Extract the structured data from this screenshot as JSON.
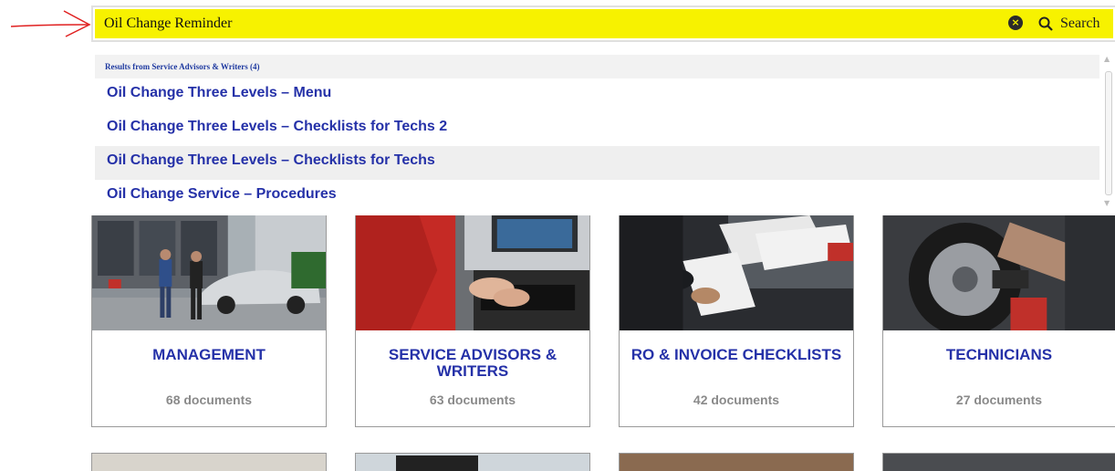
{
  "search": {
    "value": "Oil Change Reminder",
    "button_label": "Search",
    "clear_icon": "close-circle-icon",
    "search_icon": "magnifier-icon"
  },
  "results": {
    "header": "Results from Service Advisors & Writers (4)",
    "items": [
      "Oil Change Three Levels – Menu",
      "Oil Change Three Levels – Checklists for Techs 2",
      "Oil Change Three Levels – Checklists for Techs",
      "Oil Change Service – Procedures"
    ],
    "active_index": 2
  },
  "cards": [
    {
      "title": "MANAGEMENT",
      "count": "68 documents"
    },
    {
      "title": "SERVICE ADVISORS & WRITERS",
      "count": "63 documents"
    },
    {
      "title": "RO & INVOICE CHECKLISTS",
      "count": "42 documents"
    },
    {
      "title": "TECHNICIANS",
      "count": "27 documents"
    }
  ],
  "colors": {
    "highlight": "#f7f200",
    "link": "#2531a8",
    "annotation": "#e02020"
  }
}
